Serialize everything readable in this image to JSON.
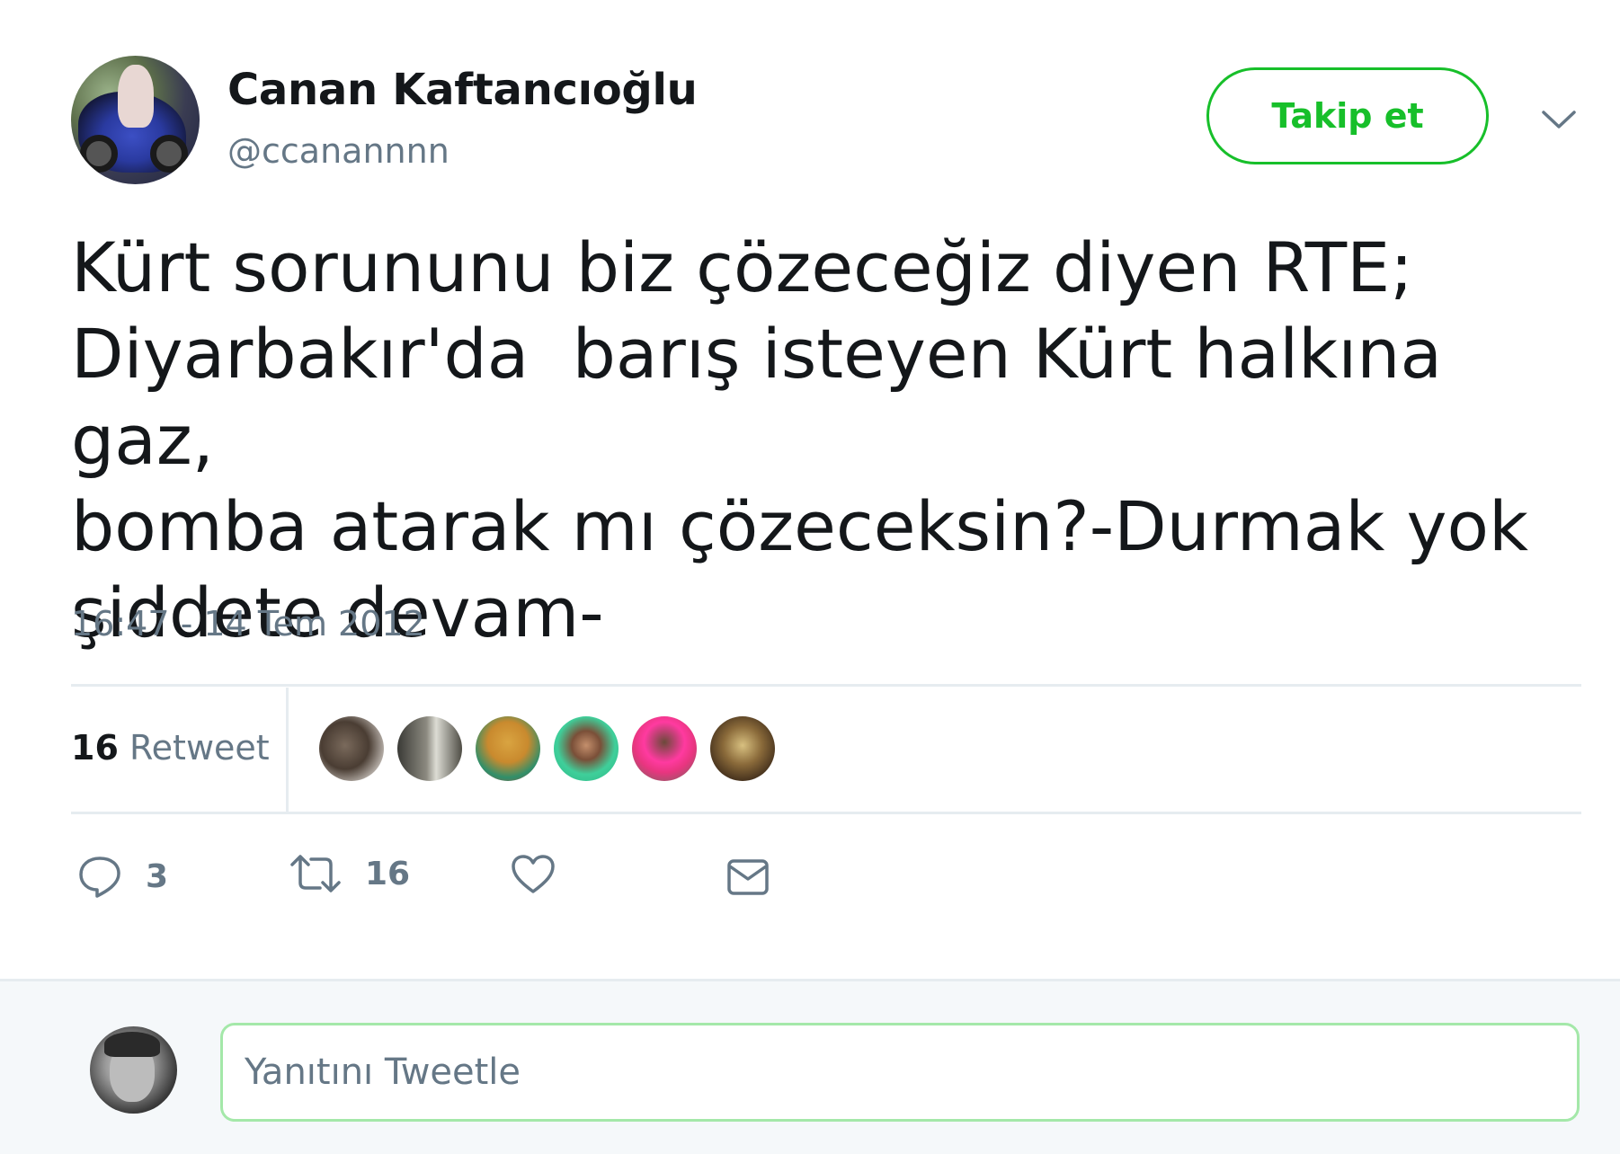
{
  "author": {
    "name": "Canan Kaftancıoğlu",
    "handle": "@ccanannnn"
  },
  "follow_button": {
    "label": "Takip et"
  },
  "menu": {
    "icon": "chevron-down-icon"
  },
  "tweet": {
    "text": "Kürt sorununu biz çözeceğiz diyen RTE;\nDiyarbakır'da  barış isteyen Kürt halkına  gaz,\nbomba atarak mı çözeceksin?-Durmak yok\nşiddete devam-",
    "timestamp": "16:47 - 14 Tem 2012"
  },
  "stats": {
    "retweet_count": "16",
    "retweet_label": "Retweet"
  },
  "actions": {
    "reply_count": "3",
    "retweet_count": "16",
    "icons": [
      "reply-icon",
      "retweet-icon",
      "like-icon",
      "direct-message-icon"
    ]
  },
  "reply": {
    "placeholder": "Yanıtını Tweetle"
  },
  "colors": {
    "accent": "#17bf2a",
    "text": "#14171a",
    "secondary": "#657786",
    "border": "#e6ecf0"
  }
}
